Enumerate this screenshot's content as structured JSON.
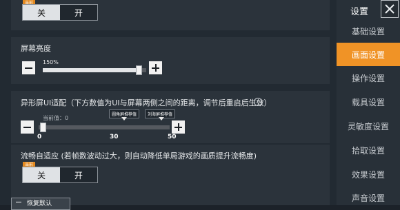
{
  "sidebar": {
    "title": "设置",
    "items": [
      {
        "label": "基础设置",
        "active": false
      },
      {
        "label": "画面设置",
        "active": true
      },
      {
        "label": "操作设置",
        "active": false
      },
      {
        "label": "载具设置",
        "active": false
      },
      {
        "label": "灵敏度设置",
        "active": false
      },
      {
        "label": "拾取设置",
        "active": false
      },
      {
        "label": "效果设置",
        "active": false
      },
      {
        "label": "声音设置",
        "active": false
      }
    ],
    "accent_color": "#f09326"
  },
  "top_toggle": {
    "tag": "当前",
    "off_label": "关",
    "on_label": "开",
    "selected": "关"
  },
  "brightness": {
    "label": "屏幕亮度",
    "value_text": "150%",
    "level_fraction": 0.93
  },
  "notch": {
    "label": "异形屏UI适配（下方数值为UI与屏幕两侧之间的距离，调节后重启后生效）",
    "current_text": "当前值：0",
    "callout_1": "圆角屏推荐值",
    "callout_2": "刘海屏推荐值",
    "ticks": [
      "0",
      "30",
      "50"
    ],
    "value": 0,
    "min": 0,
    "max": 50
  },
  "smooth": {
    "label": "流畅自适应 (若帧数波动过大，则自动降低单局游戏的画质提升流畅度)",
    "tag": "当前",
    "off_label": "关",
    "on_label": "开",
    "selected": "关"
  },
  "bottom_button": {
    "label": "恢复默认"
  }
}
